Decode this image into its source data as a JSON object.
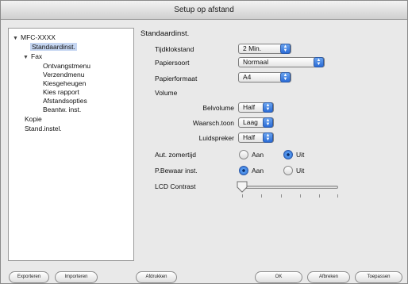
{
  "window": {
    "title": "Setup op afstand"
  },
  "tree": {
    "root": "MFC-XXXX",
    "items": [
      {
        "label": "Standaardinst."
      },
      {
        "label": "Fax"
      },
      {
        "label": "Ontvangstmenu"
      },
      {
        "label": "Verzendmenu"
      },
      {
        "label": "Kiesgeheugen"
      },
      {
        "label": "Kies rapport"
      },
      {
        "label": "Afstandsopties"
      },
      {
        "label": "Beantw. inst."
      },
      {
        "label": "Kopie"
      },
      {
        "label": "Stand.instel."
      }
    ]
  },
  "settings": {
    "section_title": "Standaardinst.",
    "tijdklokstand": {
      "label": "Tijdklokstand",
      "value": "2 Min."
    },
    "papiersoort": {
      "label": "Papiersoort",
      "value": "Normaal"
    },
    "papierformaat": {
      "label": "Papierformaat",
      "value": "A4"
    },
    "volume": {
      "label": "Volume",
      "belvolume": {
        "label": "Belvolume",
        "value": "Half"
      },
      "waarsch": {
        "label": "Waarsch.toon",
        "value": "Laag"
      },
      "luidspreker": {
        "label": "Luidspreker",
        "value": "Half"
      }
    },
    "zomertijd": {
      "label": "Aut. zomertijd",
      "options": [
        "Aan",
        "Uit"
      ],
      "selected": "Uit"
    },
    "bewaar": {
      "label": "P.Bewaar inst.",
      "options": [
        "Aan",
        "Uit"
      ],
      "selected": "Aan"
    },
    "lcd": {
      "label": "LCD Contrast",
      "level": 0
    }
  },
  "buttons": {
    "export": "Exporteren",
    "import": "Importeren",
    "print": "Afdrukken",
    "ok": "OK",
    "cancel": "Afbreken",
    "apply": "Toepassen"
  },
  "icons": {
    "expanded": "disclosure-triangle-down",
    "popup": "updown-arrows",
    "slider": "slider-thumb"
  }
}
